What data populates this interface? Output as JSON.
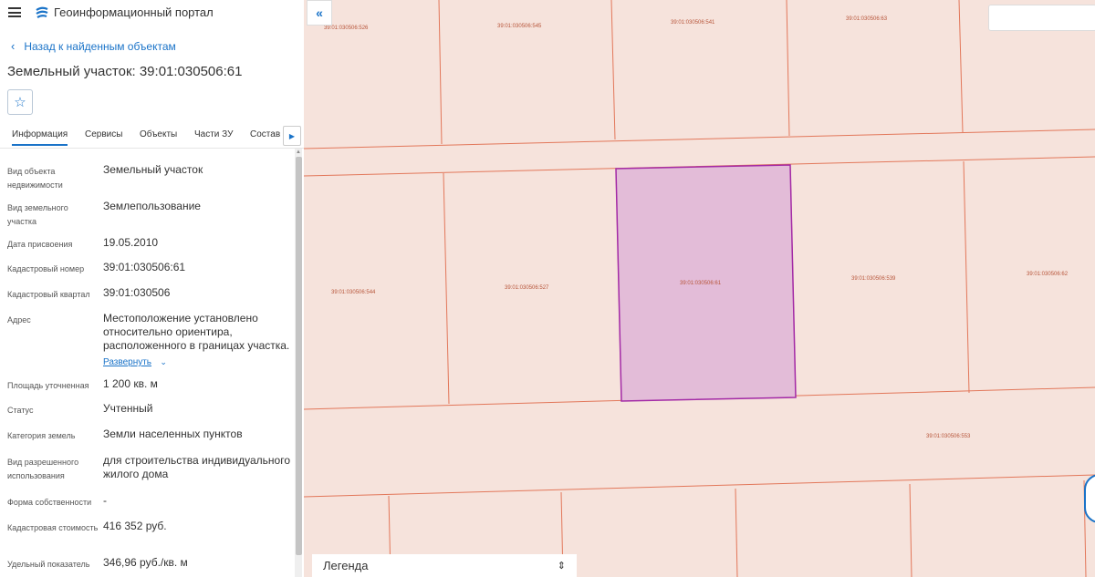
{
  "header": {
    "app_title": "Геоинформационный портал",
    "menu_icon": "hamburger-icon",
    "logo_icon": "portal-logo-icon"
  },
  "nav": {
    "back_label": "Назад к найденным объектам"
  },
  "object": {
    "title": "Земельный участок: 39:01:030506:61",
    "favorite_icon": "star-icon"
  },
  "tabs": [
    "Информация",
    "Сервисы",
    "Объекты",
    "Части ЗУ",
    "Состав"
  ],
  "active_tab": "Информация",
  "properties": [
    {
      "label": "Вид объекта недвижимости",
      "value": "Земельный участок"
    },
    {
      "label": "Вид земельного участка",
      "value": "Землепользование"
    },
    {
      "label": "Дата присвоения",
      "value": "19.05.2010"
    },
    {
      "label": "Кадастровый номер",
      "value": "39:01:030506:61"
    },
    {
      "label": "Кадастровый квартал",
      "value": "39:01:030506"
    },
    {
      "label": "Адрес",
      "value": "Местоположение установлено относительно ориентира, расположенного в границах участка.",
      "expand": "Развернуть"
    },
    {
      "label": "Площадь уточненная",
      "value": "1 200 кв. м"
    },
    {
      "label": "Статус",
      "value": "Учтенный"
    },
    {
      "label": "Категория земель",
      "value": "Земли населенных пунктов"
    },
    {
      "label": "Вид разрешенного использования",
      "value": "для строительства индивидуального жилого дома"
    },
    {
      "label": "Форма собственности",
      "value": "-"
    },
    {
      "label": "Кадастровая стоимость",
      "value": "416 352 руб."
    },
    {
      "label": "Удельный показатель",
      "value": "346,96 руб./кв. м"
    }
  ],
  "map": {
    "parcels": [
      "39:01:030506:526",
      "39:01:030506:545",
      "39:01:030506:541",
      "39:01:030506:63",
      "39:01:030506:544",
      "39:01:030506:527",
      "39:01:030506:61",
      "39:01:030506:539",
      "39:01:030506:62",
      "39:01:030506:553"
    ],
    "selected_parcel": "39:01:030506:61",
    "colors": {
      "background": "#f6e3dc",
      "border": "#e2775a",
      "selected_fill": "#e3bcd8",
      "selected_border": "#a32aa6"
    }
  },
  "legend": {
    "label": "Легенда"
  }
}
